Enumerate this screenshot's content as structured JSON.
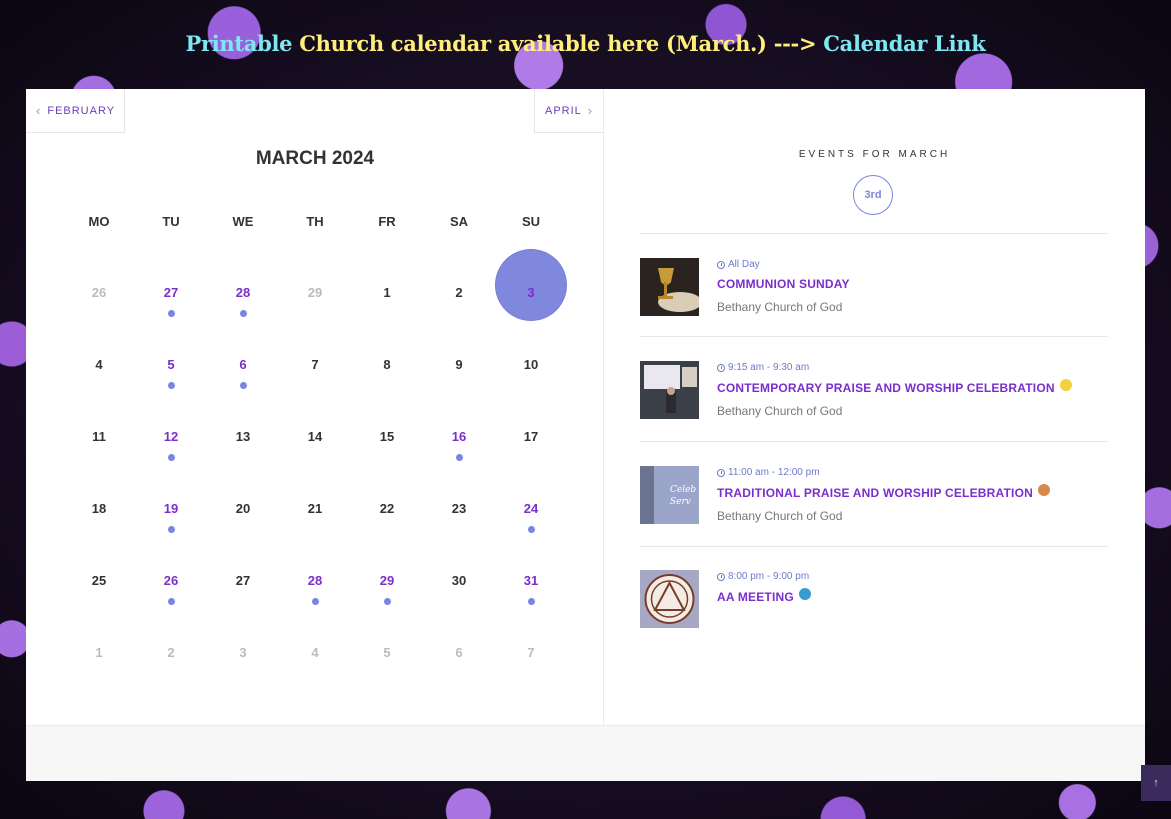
{
  "banner": {
    "part1": "Printable",
    "part2": "Church calendar available here (March.) --->",
    "link": "Calendar Link"
  },
  "nav": {
    "prev_label": "FEBRUARY",
    "next_label": "APRIL"
  },
  "calendar": {
    "title": "MARCH 2024",
    "weekdays": [
      "MO",
      "TU",
      "WE",
      "TH",
      "FR",
      "SA",
      "SU"
    ],
    "weeks": [
      [
        {
          "d": "26",
          "other": true
        },
        {
          "d": "27",
          "ev": true
        },
        {
          "d": "28",
          "ev": true
        },
        {
          "d": "29",
          "other": true
        },
        {
          "d": "1"
        },
        {
          "d": "2"
        },
        {
          "d": "3",
          "selected": true
        }
      ],
      [
        {
          "d": "4"
        },
        {
          "d": "5",
          "ev": true
        },
        {
          "d": "6",
          "ev": true
        },
        {
          "d": "7"
        },
        {
          "d": "8"
        },
        {
          "d": "9"
        },
        {
          "d": "10"
        }
      ],
      [
        {
          "d": "11"
        },
        {
          "d": "12",
          "ev": true
        },
        {
          "d": "13"
        },
        {
          "d": "14"
        },
        {
          "d": "15"
        },
        {
          "d": "16",
          "ev": true
        },
        {
          "d": "17"
        }
      ],
      [
        {
          "d": "18"
        },
        {
          "d": "19",
          "ev": true
        },
        {
          "d": "20"
        },
        {
          "d": "21"
        },
        {
          "d": "22"
        },
        {
          "d": "23"
        },
        {
          "d": "24",
          "ev": true
        }
      ],
      [
        {
          "d": "25"
        },
        {
          "d": "26",
          "ev": true
        },
        {
          "d": "27"
        },
        {
          "d": "28",
          "ev": true
        },
        {
          "d": "29",
          "ev": true
        },
        {
          "d": "30"
        },
        {
          "d": "31",
          "ev": true
        }
      ],
      [
        {
          "d": "1",
          "other": true
        },
        {
          "d": "2",
          "other": true
        },
        {
          "d": "3",
          "other": true
        },
        {
          "d": "4",
          "other": true
        },
        {
          "d": "5",
          "other": true
        },
        {
          "d": "6",
          "other": true
        },
        {
          "d": "7",
          "other": true
        }
      ]
    ]
  },
  "events_panel": {
    "heading": "EVENTS FOR MARCH",
    "selected_date": "3rd",
    "events": [
      {
        "time": "All Day",
        "title": "COMMUNION SUNDAY",
        "location": "Bethany Church of God",
        "dot_color": "",
        "thumb": "communion"
      },
      {
        "time": "9:15 am - 9:30 am",
        "title": "CONTEMPORARY PRAISE AND WORSHIP CELEBRATION",
        "location": "Bethany Church of God",
        "dot_color": "#f2d13c",
        "thumb": "contemporary"
      },
      {
        "time": "11:00 am - 12:00 pm",
        "title": "TRADITIONAL PRAISE AND WORSHIP CELEBRATION",
        "location": "Bethany Church of God",
        "dot_color": "#d6894a",
        "thumb": "traditional"
      },
      {
        "time": "8:00 pm - 9:00 pm",
        "title": "AA MEETING",
        "location": "",
        "dot_color": "#3a9bd0",
        "thumb": "aa"
      }
    ]
  },
  "colors": {
    "accent": "#7a2ecc",
    "dot": "#7a86db"
  }
}
